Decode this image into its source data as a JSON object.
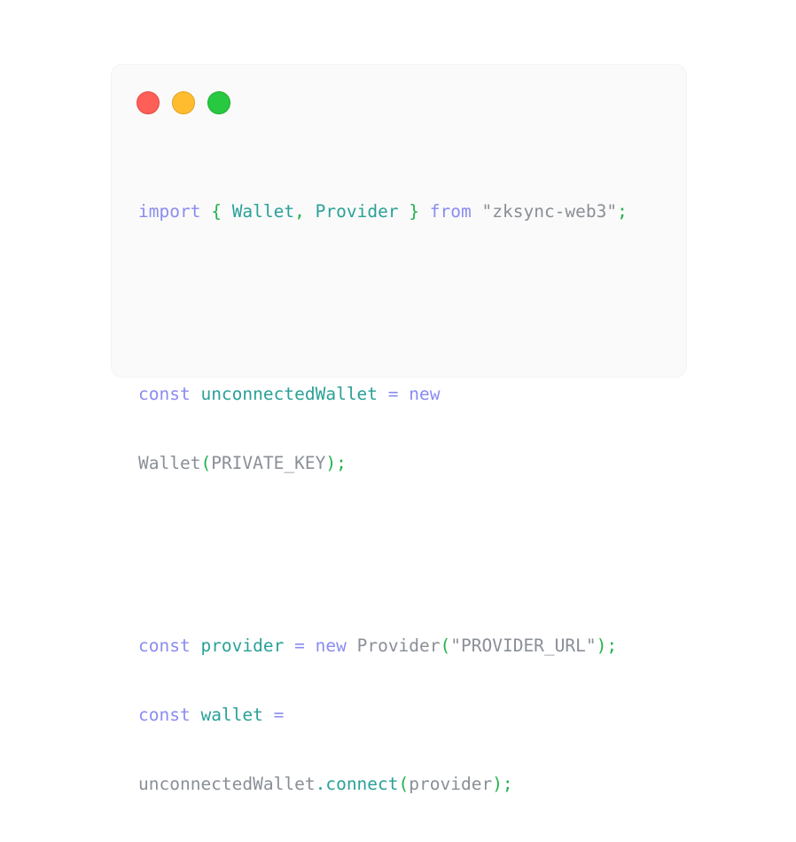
{
  "window": {
    "traffic_lights": {
      "close_color": "#fe5f57",
      "minimize_color": "#febc2e",
      "zoom_color": "#28c840"
    }
  },
  "code": {
    "line1": {
      "kw_import": "import",
      "brace_open": " { ",
      "id_wallet": "Wallet",
      "comma": ", ",
      "id_provider": "Provider",
      "brace_close": " } ",
      "kw_from": "from",
      "space": " ",
      "str_module": "\"zksync-web3\"",
      "semi": ";"
    },
    "line2": {
      "kw_const": "const",
      "space1": " ",
      "id_unconnected": "unconnectedWallet",
      "eq": " = ",
      "kw_new": "new"
    },
    "line3": {
      "tx_wallet": "Wallet",
      "paren_open": "(",
      "tx_arg": "PRIVATE_KEY",
      "paren_close": ");"
    },
    "line4": {
      "kw_const": "const",
      "space1": " ",
      "id_provider": "provider",
      "eq": " = ",
      "kw_new": "new",
      "space2": " ",
      "tx_provider": "Provider",
      "paren_open": "(",
      "str_url": "\"PROVIDER_URL\"",
      "paren_close": ");"
    },
    "line5": {
      "kw_const": "const",
      "space1": " ",
      "id_wallet": "wallet",
      "eq": " ="
    },
    "line6": {
      "tx_unconnected": "unconnectedWallet",
      "dot_connect": ".connect",
      "paren_open": "(",
      "tx_arg": "provider",
      "paren_close": ");"
    }
  }
}
